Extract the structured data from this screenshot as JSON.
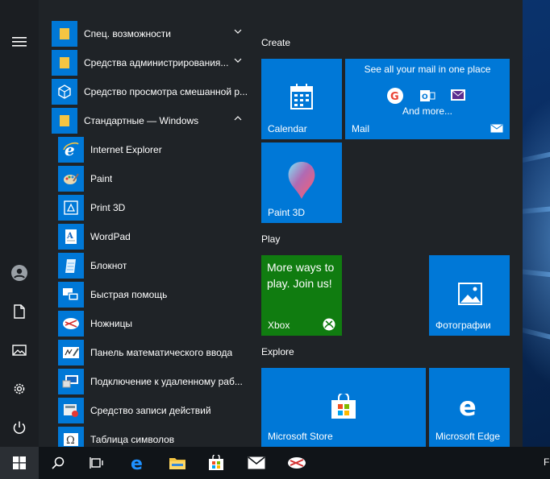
{
  "app_list": [
    {
      "label": "Спец. возможности",
      "kind": "folder",
      "expanded": false
    },
    {
      "label": "Средства администрирования...",
      "kind": "folder",
      "expanded": false
    },
    {
      "label": "Средство просмотра смешанной р...",
      "kind": "app",
      "icon": "mixed-reality-viewer-icon"
    },
    {
      "label": "Стандартные — Windows",
      "kind": "folder",
      "expanded": true
    },
    {
      "label": "Internet Explorer",
      "kind": "app",
      "icon": "internet-explorer-icon"
    },
    {
      "label": "Paint",
      "kind": "app",
      "icon": "paint-icon"
    },
    {
      "label": "Print 3D",
      "kind": "app",
      "icon": "print-3d-icon"
    },
    {
      "label": "WordPad",
      "kind": "app",
      "icon": "wordpad-icon"
    },
    {
      "label": "Блокнот",
      "kind": "app",
      "icon": "notepad-icon"
    },
    {
      "label": "Быстрая помощь",
      "kind": "app",
      "icon": "quick-assist-icon"
    },
    {
      "label": "Ножницы",
      "kind": "app",
      "icon": "snipping-tool-icon"
    },
    {
      "label": "Панель математического ввода",
      "kind": "app",
      "icon": "math-input-icon"
    },
    {
      "label": "Подключение к удаленному раб...",
      "kind": "app",
      "icon": "remote-desktop-icon"
    },
    {
      "label": "Средство записи действий",
      "kind": "app",
      "icon": "steps-recorder-icon"
    },
    {
      "label": "Таблица символов",
      "kind": "app",
      "icon": "character-map-icon"
    }
  ],
  "groups": {
    "create": "Create",
    "play": "Play",
    "explore": "Explore"
  },
  "tiles": {
    "calendar": "Calendar",
    "mail": "Mail",
    "mail_header": "See all your mail in one place",
    "mail_more": "And more...",
    "paint3d": "Paint 3D",
    "xbox": "Xbox",
    "xbox_promo": "More ways to play. Join us!",
    "photos": "Фотографии",
    "store": "Microsoft Store",
    "edge": "Microsoft Edge"
  },
  "taskbar": {
    "right_edge_text": "F"
  },
  "colors": {
    "accent": "#0078d7",
    "xbox": "#107c10",
    "menu_bg": "#1f2327",
    "taskbar_bg": "#101418"
  }
}
